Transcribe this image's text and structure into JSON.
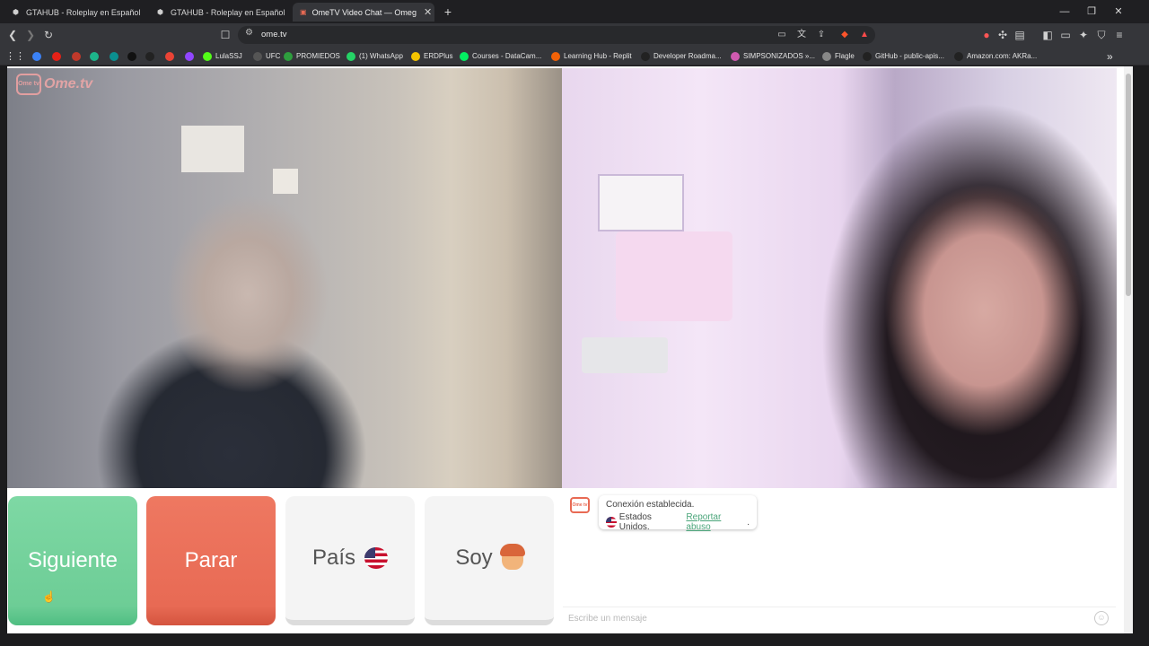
{
  "browser": {
    "tabs": [
      {
        "title": "GTAHUB - Roleplay en Español",
        "active": false
      },
      {
        "title": "GTAHUB - Roleplay en Español",
        "active": false
      },
      {
        "title": "OmeTV Video Chat — Omeg",
        "active": true
      }
    ],
    "new_tab_label": "+",
    "window_controls": {
      "minimize": "—",
      "maximize": "❐",
      "close": "✕"
    },
    "url": "ome.tv",
    "bookmarks": [
      {
        "label": "",
        "icon": "blue-play-icon",
        "color": "#3b82f6"
      },
      {
        "label": "",
        "icon": "youtube-icon",
        "color": "#e62117"
      },
      {
        "label": "",
        "icon": "red-icon",
        "color": "#c0392b"
      },
      {
        "label": "",
        "icon": "green-circle-icon",
        "color": "#1db48a"
      },
      {
        "label": "",
        "icon": "teal-icon",
        "color": "#0b8f8f"
      },
      {
        "label": "",
        "icon": "x-icon",
        "color": "#111111"
      },
      {
        "label": "",
        "icon": "threads-icon",
        "color": "#222222"
      },
      {
        "label": "",
        "icon": "gmail-icon",
        "color": "#ea4335"
      },
      {
        "label": "",
        "icon": "twitch-icon",
        "color": "#9146ff"
      },
      {
        "label": "LulaSSJ",
        "icon": "kick-icon",
        "color": "#53fc18"
      },
      {
        "label": "UFC",
        "icon": "ufc-icon",
        "color": "#555555"
      },
      {
        "label": "PROMIEDOS",
        "icon": "promiedos-icon",
        "color": "#2e9e3e"
      },
      {
        "label": "(1) WhatsApp",
        "icon": "whatsapp-icon",
        "color": "#25d366"
      },
      {
        "label": "ERDPlus",
        "icon": "erdplus-icon",
        "color": "#f5c400"
      },
      {
        "label": "Courses - DataCam...",
        "icon": "datacamp-icon",
        "color": "#03ef62"
      },
      {
        "label": "Learning Hub - Replit",
        "icon": "replit-icon",
        "color": "#f26207"
      },
      {
        "label": "Developer Roadma...",
        "icon": "roadmap-icon",
        "color": "#222222"
      },
      {
        "label": "SIMPSONIZADOS »...",
        "icon": "simpsons-icon",
        "color": "#d05ab0"
      },
      {
        "label": "Flagle",
        "icon": "flagle-icon",
        "color": "#888888"
      },
      {
        "label": "GitHub - public-apis...",
        "icon": "github-icon",
        "color": "#222222"
      },
      {
        "label": "Amazon.com: AKRa...",
        "icon": "amazon-icon",
        "color": "#222222"
      }
    ],
    "bookmarks_overflow": "»"
  },
  "app": {
    "brand": "Ome.tv",
    "logo_badge": "Ome tv",
    "buttons": {
      "next": "Siguiente",
      "stop": "Parar",
      "country": "País",
      "gender": "Soy"
    },
    "chat": {
      "status": "Conexión establecida.",
      "country": "Estados Unidos.",
      "report": "Reportar abuso",
      "report_suffix": ".",
      "input_placeholder": "Escribe un mensaje"
    },
    "colors": {
      "next": "#6dcd96",
      "stop": "#e86a54",
      "neutral": "#f4f4f4",
      "link": "#4aa57a"
    }
  }
}
